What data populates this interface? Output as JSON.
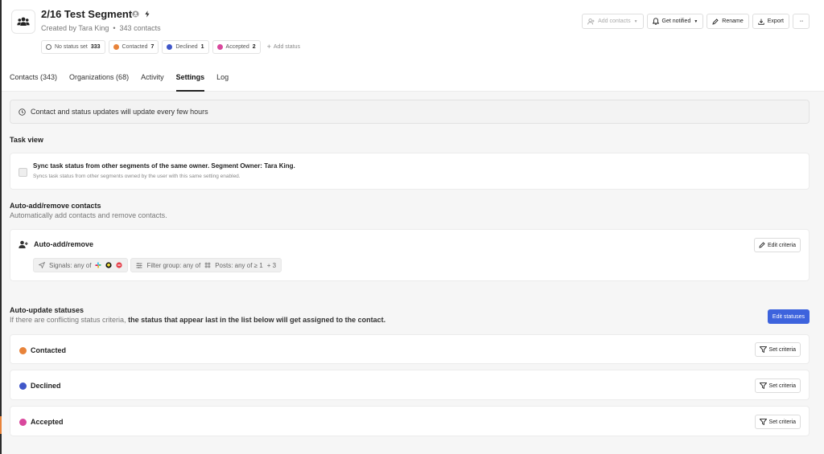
{
  "segment": {
    "title": "2/16 Test Segment",
    "created_by": "Created by Tara King",
    "separator": "•",
    "contacts_count": "343 contacts"
  },
  "status_bar": {
    "items": [
      {
        "label": "No status set",
        "count": "333",
        "color": null
      },
      {
        "label": "Contacted",
        "count": "7",
        "color": "#e8833a"
      },
      {
        "label": "Declined",
        "count": "1",
        "color": "#4057c9"
      },
      {
        "label": "Accepted",
        "count": "2",
        "color": "#d9489d"
      }
    ],
    "add_label": "Add status"
  },
  "toolbar": {
    "add_contacts": "Add contacts",
    "get_notified": "Get notified",
    "rename": "Rename",
    "export": "Export",
    "more": "···"
  },
  "tabs": [
    {
      "label": "Contacts (343)",
      "active": false
    },
    {
      "label": "Organizations (68)",
      "active": false
    },
    {
      "label": "Activity",
      "active": false
    },
    {
      "label": "Settings",
      "active": true
    },
    {
      "label": "Log",
      "active": false
    }
  ],
  "settings": {
    "notice": "Contact and status updates will update every few hours",
    "task_view": {
      "heading": "Task view",
      "sync_title": "Sync task status from other segments of the same owner. Segment Owner: Tara King.",
      "sync_sub": "Syncs task status from other segments owned by the user with this same setting enabled."
    },
    "auto_add": {
      "heading": "Auto-add/remove contacts",
      "sub": "Automatically add contacts and remove contacts.",
      "card_title": "Auto-add/remove",
      "edit_label": "Edit criteria",
      "signals_label": "Signals: any of",
      "filter_label": "Filter group: any of",
      "posts_label": "Posts: any of ≥ 1",
      "more_label": "+ 3"
    },
    "auto_update": {
      "heading": "Auto-update statuses",
      "sub_prefix": "If there are conflicting status criteria,",
      "sub_bold": "the status that appear last in the list below will get assigned to the contact.",
      "edit_statuses": "Edit statuses",
      "statuses": [
        {
          "label": "Contacted",
          "color": "#e8833a",
          "button": "Set criteria"
        },
        {
          "label": "Declined",
          "color": "#4057c9",
          "button": "Set criteria"
        },
        {
          "label": "Accepted",
          "color": "#d9489d",
          "button": "Set criteria"
        }
      ]
    }
  },
  "colors": {
    "accent": "#3d63dd",
    "active_edge": "#e8833a"
  }
}
